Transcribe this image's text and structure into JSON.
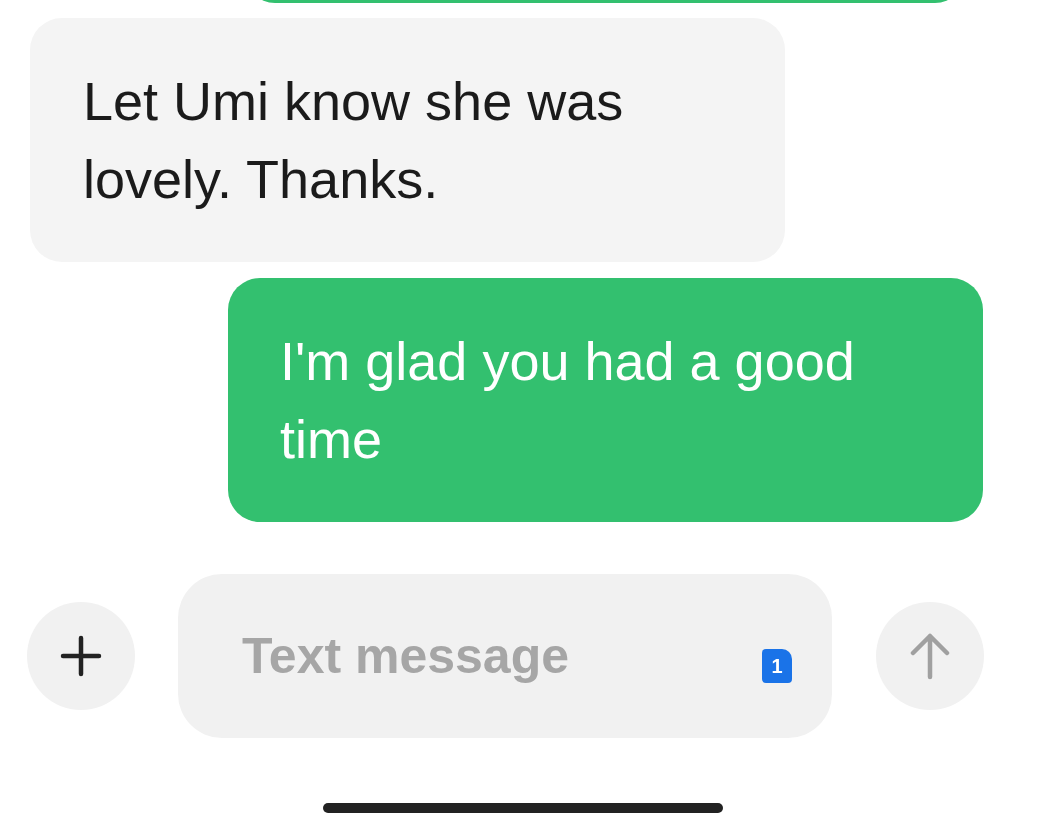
{
  "messages": [
    {
      "sent": false,
      "text": "Let Umi know she was lovely. Thanks."
    },
    {
      "sent": true,
      "text": "I'm glad you had a good time"
    }
  ],
  "composer": {
    "placeholder": "Text message",
    "sim_badge": "1"
  }
}
